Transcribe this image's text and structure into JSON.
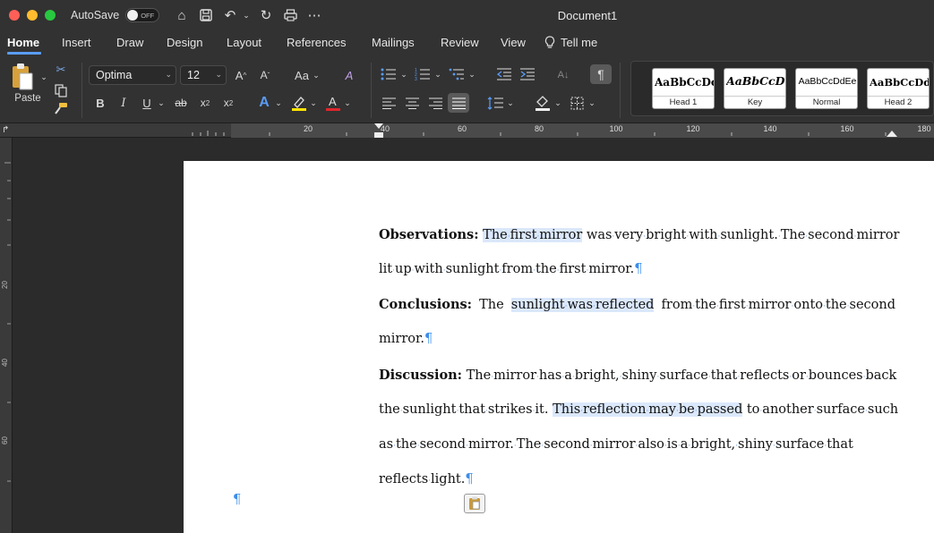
{
  "window": {
    "autosave_label": "AutoSave",
    "autosave_state": "OFF",
    "title": "Document1",
    "lights": [
      "#fe5f57",
      "#febc2e",
      "#28c840"
    ]
  },
  "tabs": [
    "Home",
    "Insert",
    "Draw",
    "Design",
    "Layout",
    "References",
    "Mailings",
    "Review",
    "View",
    "Tell me"
  ],
  "ribbon": {
    "paste_label": "Paste",
    "font_name": "Optima",
    "font_size": "12",
    "styles": [
      {
        "preview": "AaBbCcDc",
        "name": "Head 1"
      },
      {
        "preview": "AaBbCcDc",
        "name": "Key"
      },
      {
        "preview": "AaBbCcDdEe",
        "name": "Normal"
      },
      {
        "preview": "AaBbCcDdE",
        "name": "Head 2"
      }
    ],
    "icons": {
      "grow_font": "A^",
      "shrink_font": "A˅",
      "change_case": "Aa",
      "bold": "B",
      "italic": "I",
      "underline": "U",
      "strikethrough": "ab",
      "subscript": "x₂",
      "superscript": "x²"
    }
  },
  "ruler": {
    "marks": [
      "20",
      "40",
      "60",
      "80",
      "100",
      "120",
      "140",
      "160",
      "180"
    ],
    "vmarks": [
      "20",
      "40",
      "60"
    ]
  },
  "document": {
    "observations": {
      "label": "Observations:",
      "highlight": "The first mirror",
      "line1_rest": "was very bright with sunlight. The second mirror",
      "line2": "lit up with sunlight from the first mirror."
    },
    "conclusions": {
      "label": "Conclusions:",
      "pre": "The",
      "highlight": "sunlight was reflected",
      "line1_rest": "from the first mirror onto the second",
      "line2": "mirror."
    },
    "discussion": {
      "label": "Discussion:",
      "line1_rest": "The mirror has a bright, shiny surface that reflects or bounces back",
      "line2_pre": "the sunlight that strikes it.",
      "highlight": "This reflection may be passed",
      "line2_rest": "to another surface such",
      "line3": "as the second mirror. The second mirror also is a bright, shiny surface that",
      "line4": "reflects light."
    },
    "pilcrow": "¶"
  }
}
